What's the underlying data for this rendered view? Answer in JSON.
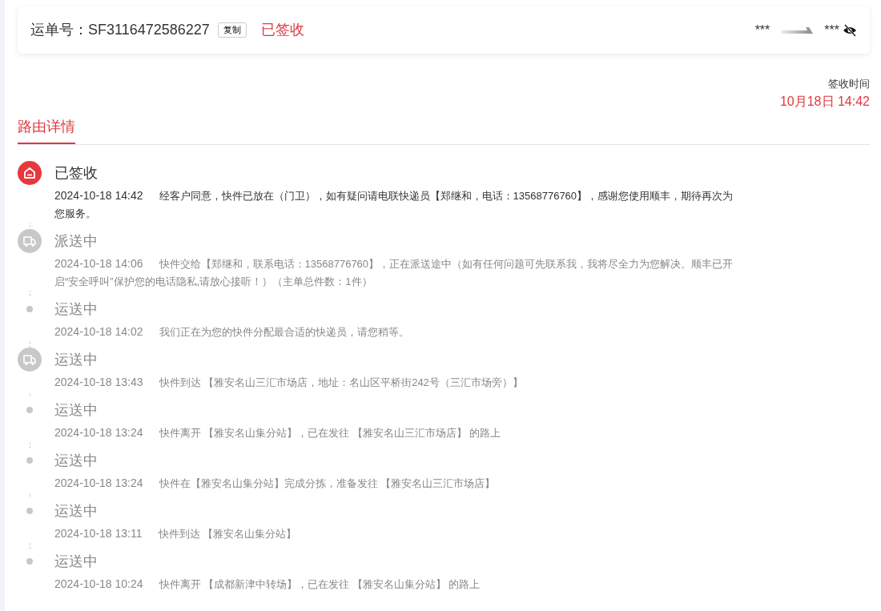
{
  "header": {
    "label": "运单号：",
    "tracking_number": "SF3116472586227",
    "copy_button": "复制",
    "status": "已签收",
    "origin": "***",
    "destination": "***"
  },
  "signed_time": {
    "label": "签收时间",
    "value": "10月18日 14:42"
  },
  "tabs": [
    {
      "label": "路由详情",
      "selected": true
    }
  ],
  "events": [
    {
      "kind": "signed",
      "current": true,
      "title": "已签收",
      "time": "2024-10-18 14:42",
      "text": "经客户同意，快件已放在（门卫），如有疑问请电联快递员【郑继和，电话：13568776760】，感谢您使用顺丰，期待再次为您服务。"
    },
    {
      "kind": "truck",
      "current": false,
      "title": "派送中",
      "time": "2024-10-18 14:06",
      "text": "快件交给【郑继和，联系电话：13568776760】，正在派送途中（如有任何问题可先联系我，我将尽全力为您解决。顺丰已开启“安全呼叫”保护您的电话隐私,请放心接听！）（主单总件数：1件）"
    },
    {
      "kind": "dot",
      "current": false,
      "title": "运送中",
      "time": "2024-10-18 14:02",
      "text": "我们正在为您的快件分配最合适的快递员，请您稍等。"
    },
    {
      "kind": "truck",
      "current": false,
      "title": "运送中",
      "time": "2024-10-18 13:43",
      "text": "快件到达 【雅安名山三汇市场店，地址：名山区平桥街242号（三汇市场旁）】"
    },
    {
      "kind": "dot",
      "current": false,
      "title": "运送中",
      "time": "2024-10-18 13:24",
      "text": "快件离开 【雅安名山集分站】，已在发往 【雅安名山三汇市场店】 的路上"
    },
    {
      "kind": "dot",
      "current": false,
      "title": "运送中",
      "time": "2024-10-18 13:24",
      "text": "快件在【雅安名山集分站】完成分拣，准备发往 【雅安名山三汇市场店】"
    },
    {
      "kind": "dot",
      "current": false,
      "title": "运送中",
      "time": "2024-10-18 13:11",
      "text": "快件到达 【雅安名山集分站】"
    },
    {
      "kind": "dot",
      "current": false,
      "title": "运送中",
      "time": "2024-10-18 10:24",
      "text": "快件离开 【成都新津中转场】，已在发往 【雅安名山集分站】 的路上"
    }
  ]
}
